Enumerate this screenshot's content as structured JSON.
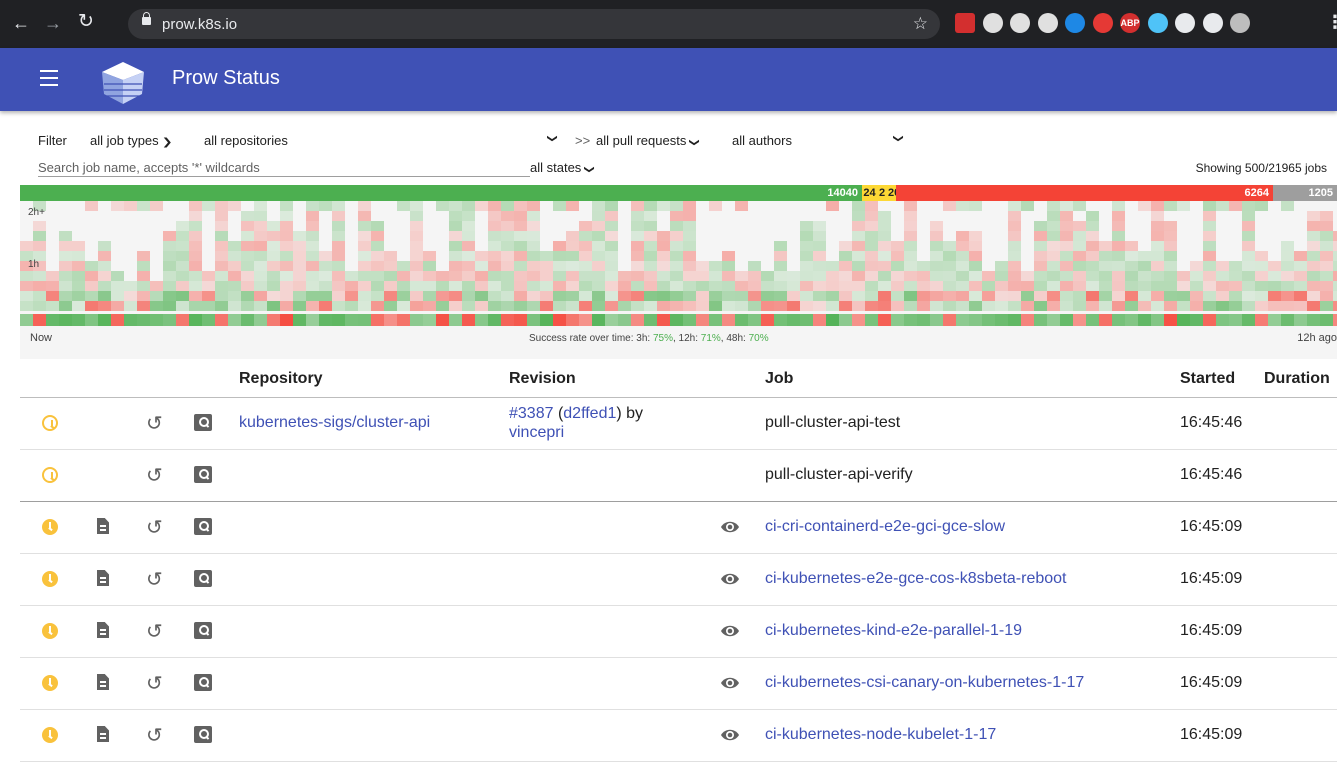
{
  "browser": {
    "url": "prow.k8s.io",
    "extensions": [
      "lastpass-icon",
      "profile-icon",
      "extension-icon",
      "extension-icon",
      "extension-icon",
      "extension-icon",
      "abp-icon",
      "extension-icon",
      "puzzle-icon",
      "cast-icon",
      "avatar-icon"
    ]
  },
  "app": {
    "title": "Prow Status"
  },
  "filters": {
    "label": "Filter",
    "job_types": "all job types",
    "repositories": "all repositories",
    "arrow": ">>",
    "pull_requests": "all pull requests",
    "authors": "all authors",
    "states": "all states",
    "search_placeholder": "Search job name, accepts '*' wildcards",
    "showing": "Showing 500/21965 jobs"
  },
  "histogram": {
    "segments": [
      {
        "label": "14040",
        "color": "#4caf50",
        "share": 0.639
      },
      {
        "label": "24",
        "color": "#fdd835",
        "share": 0.0113
      },
      {
        "label": "2",
        "color": "#fdd835",
        "share": 0.0075
      },
      {
        "label": "20",
        "color": "#fdd835",
        "share": 0.0072
      },
      {
        "label": "6264",
        "color": "#f44336",
        "share": 0.2864
      },
      {
        "label": "1205",
        "color": "#9e9e9e",
        "share": 0.0486
      }
    ],
    "y_top": "2h+",
    "y_mid": "1h",
    "now": "Now",
    "ago": "12h ago",
    "rate_prefix": "Success rate over time: 3h: ",
    "rate_3h": "75%",
    "rate_12h_prefix": ", 12h: ",
    "rate_12h": "71%",
    "rate_48h_prefix": ", 48h: ",
    "rate_48h": "70%",
    "colors": {
      "success": "#4caf50",
      "failure": "#f44336"
    }
  },
  "table": {
    "headers": {
      "repository": "Repository",
      "revision": "Revision",
      "job": "Job",
      "started": "Started",
      "duration": "Duration"
    },
    "rows": [
      {
        "state": "pending-outline",
        "log": false,
        "repo": "kubernetes-sigs/cluster-api",
        "pr": "#3387",
        "sha": "d2ffed1",
        "by": "by",
        "author": "vincepri",
        "job": "pull-cluster-api-test",
        "job_link": false,
        "eye": false,
        "started": "16:45:46"
      },
      {
        "state": "pending-outline",
        "log": false,
        "repo": "",
        "pr": "",
        "sha": "",
        "by": "",
        "author": "",
        "job": "pull-cluster-api-verify",
        "job_link": false,
        "eye": false,
        "started": "16:45:46"
      },
      {
        "state": "pending",
        "log": true,
        "repo": "",
        "pr": "",
        "sha": "",
        "by": "",
        "author": "",
        "job": "ci-cri-containerd-e2e-gci-gce-slow",
        "job_link": true,
        "eye": true,
        "started": "16:45:09"
      },
      {
        "state": "pending",
        "log": true,
        "repo": "",
        "pr": "",
        "sha": "",
        "by": "",
        "author": "",
        "job": "ci-kubernetes-e2e-gce-cos-k8sbeta-reboot",
        "job_link": true,
        "eye": true,
        "started": "16:45:09"
      },
      {
        "state": "pending",
        "log": true,
        "repo": "",
        "pr": "",
        "sha": "",
        "by": "",
        "author": "",
        "job": "ci-kubernetes-kind-e2e-parallel-1-19",
        "job_link": true,
        "eye": true,
        "started": "16:45:09"
      },
      {
        "state": "pending",
        "log": true,
        "repo": "",
        "pr": "",
        "sha": "",
        "by": "",
        "author": "",
        "job": "ci-kubernetes-csi-canary-on-kubernetes-1-17",
        "job_link": true,
        "eye": true,
        "started": "16:45:09"
      },
      {
        "state": "pending",
        "log": true,
        "repo": "",
        "pr": "",
        "sha": "",
        "by": "",
        "author": "",
        "job": "ci-kubernetes-node-kubelet-1-17",
        "job_link": true,
        "eye": true,
        "started": "16:45:09"
      }
    ]
  }
}
